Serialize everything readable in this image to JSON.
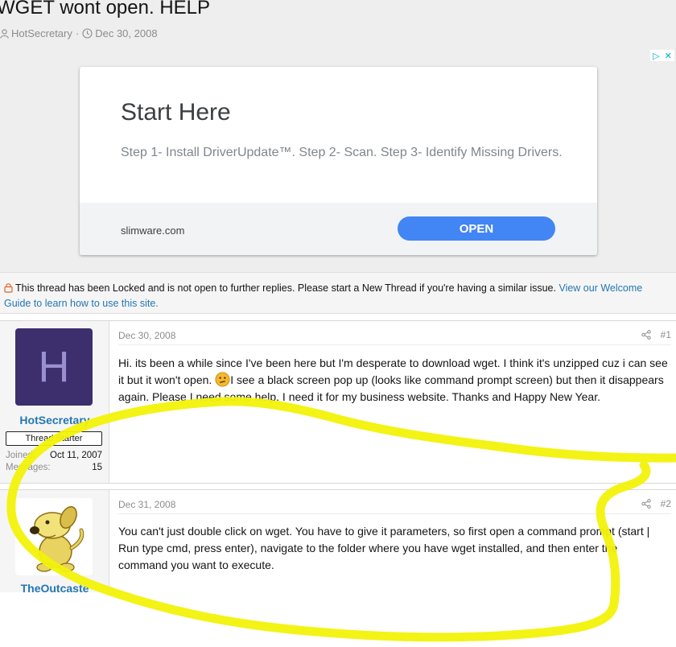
{
  "thread": {
    "title": "WGET wont open. HELP",
    "author": "HotSecretary",
    "separator": "·",
    "date": "Dec 30, 2008"
  },
  "ad": {
    "headline": "Start Here",
    "description": "Step 1- Install DriverUpdate™. Step 2- Scan. Step 3- Identify Missing Drivers.",
    "domain": "slimware.com",
    "cta": "OPEN",
    "badge_play": "▷",
    "badge_close": "✕"
  },
  "locked_notice": {
    "text": "This thread has been Locked and is not open to further replies. Please start a New Thread if you're having a similar issue.",
    "link": "View our Welcome Guide to learn how to use this site."
  },
  "posts": [
    {
      "username": "HotSecretary",
      "avatar_letter": "H",
      "badge": "Thread Starter",
      "joined_label": "Joined:",
      "joined_value": "Oct 11, 2007",
      "messages_label": "Messages:",
      "messages_value": "15",
      "date": "Dec 30, 2008",
      "number": "#1",
      "body_a": "Hi. its been a while since I've been here but I'm desperate to download wget. I think it's unzipped cuz i can see it but it won't open.",
      "body_b": "I see a black screen pop up (looks like command prompt screen) but then it disappears again. Please I need some help. I need it for my business website. Thanks and Happy New Year."
    },
    {
      "username": "TheOutcaste",
      "date": "Dec 31, 2008",
      "number": "#2",
      "body": "You can't just double click on wget. You have to give it parameters, so first open a command prompt (start | Run type cmd, press enter), navigate to the folder where you have wget installed, and then enter the command you want to execute."
    }
  ],
  "colors": {
    "link": "#2577b1",
    "avatar_bg": "#3d2e6e",
    "ad_button": "#4285f4",
    "highlight_scribble": "#f2f20a"
  }
}
